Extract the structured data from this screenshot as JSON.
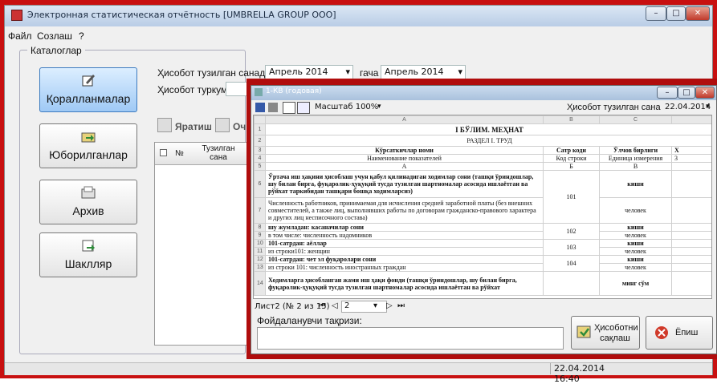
{
  "window": {
    "title": "Электронная статистическая отчётность [UMBRELLA GROUP OOO]",
    "min": "–",
    "max": "□",
    "close": "✕"
  },
  "menu": {
    "items": [
      "Файл",
      "Созлаш",
      "?"
    ]
  },
  "catalog": {
    "legend": "Каталоглар",
    "items": [
      {
        "label": "Қоралланмалар",
        "icon": "pen-paper-icon"
      },
      {
        "label": "Юборилганлар",
        "icon": "folder-arrow-icon"
      },
      {
        "label": "Архив",
        "icon": "archive-folder-icon"
      },
      {
        "label": "Шаклляр",
        "icon": "forms-icon"
      }
    ]
  },
  "filters": {
    "from_label": "Ҳисобот тузилган санадан",
    "from_value": "Апрель  2014",
    "to_label": "гача",
    "to_value": "Апрель  2014",
    "type_label": "Ҳисобот туркуми"
  },
  "actions": {
    "create": "Яратиш",
    "open": "Оч"
  },
  "grid": {
    "col_no": "№",
    "col_date": "Тузилган сана"
  },
  "status": {
    "datetime": "22.04.2014 16:40"
  },
  "report": {
    "title": "1-КВ (годовая)",
    "scale_label": "Масштаб 100%",
    "date_label": "Ҳисобот тузилган сана",
    "date_value": "22.04.2014",
    "col_letters": [
      "A",
      "B",
      "C"
    ],
    "row_numbers": [
      "1",
      "2",
      "3",
      "4",
      "5",
      "6",
      "7",
      "8",
      "9",
      "10",
      "11",
      "12",
      "13",
      "14"
    ],
    "section_title": "I БЎЛИМ. МЕҲНАТ",
    "section_sub": "РАЗДЕЛ I. ТРУД",
    "headers": {
      "name_uz": "Кўрсаткичлар номи",
      "code_uz": "Сатр коди",
      "unit_uz": "Ўлчов бирлиги",
      "name_ru": "Наименование показателей",
      "code_ru": "Код строки",
      "unit_ru": "Единица измерения",
      "letter_a": "А",
      "letter_b": "Б",
      "letter_c": "В",
      "extra_col": "Х",
      "extra_num": "3"
    },
    "rows": [
      {
        "text": "Ўртача иш ҳақини ҳисоблаш учун қабул қилинадиган ходимлар сони (ташқи ўриндошлар, шу билан бирга, фуқаролик-ҳуқуқий тусда тузилган шартномалар асосида ишлаётган ва рўйхат таркибидан ташқари бошқа ходимларсиз)",
        "code": "101",
        "unit": "киши"
      },
      {
        "text": "Численность работников, принимаемая для исчисления средней заработной платы (без внешних совместителей, а также лиц, выполнявших работы по договорам гражданско-правового характера и других лиц несписочного состава)",
        "unit": "человек"
      },
      {
        "text": "шу жумладан: касаначилар сони",
        "code": "102",
        "unit": "киши"
      },
      {
        "text": "в том числе: численность надомников",
        "unit": "человек"
      },
      {
        "text": "101-сатрдан: аёллар",
        "code": "103",
        "unit": "киши"
      },
      {
        "text": "из строки101: женщин",
        "unit": "человек"
      },
      {
        "text": "101-сатрдан: чет эл фуқаролари сони",
        "code": "104",
        "unit": "киши"
      },
      {
        "text": "из строки 101: численность иностранных граждан",
        "unit": "человек"
      },
      {
        "text": "Ходимларга ҳисобланган жами иш ҳақи фонди (ташқи ўриндошлар, шу билан бирга, фуқаролик-ҳуқуқий тусда тузилган шартномалар асосида ишлаётган ва рўйхат",
        "unit": "минг сўм"
      }
    ],
    "sheet_nav": "Лист2 (№ 2 из 15)",
    "page_value": "2",
    "comment_label": "Фойдаланувчи тақризи:",
    "save_label": "Ҳисоботни сақлаш",
    "exit_label": "Ёпиш"
  },
  "colors": {
    "frame": "#c81010",
    "active": "#9fc9f5"
  }
}
